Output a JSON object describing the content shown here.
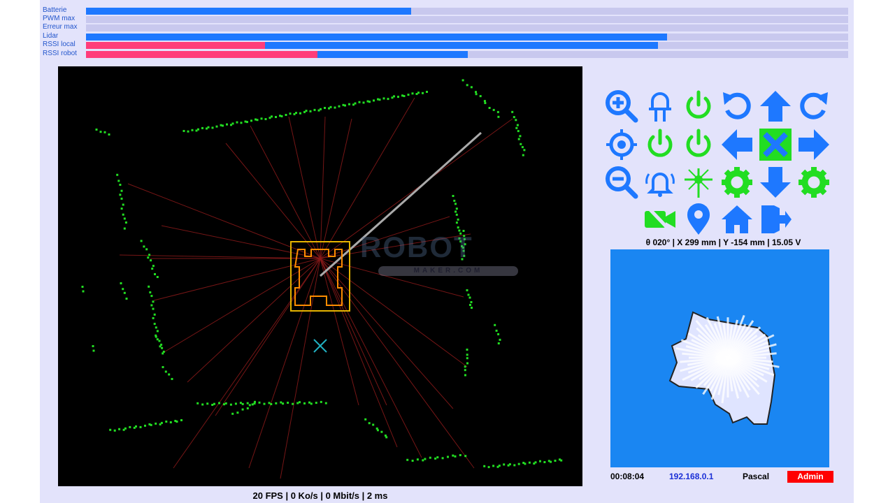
{
  "bars": [
    {
      "label": "Batterie",
      "value": 0.427,
      "secondary": 0
    },
    {
      "label": "PWM max",
      "value": 0,
      "secondary": 0
    },
    {
      "label": "Erreur max",
      "value": 0,
      "secondary": 0
    },
    {
      "label": "Lidar",
      "value": 0.762,
      "secondary": 0
    },
    {
      "label": "RSSI local",
      "value": 0.75,
      "secondary": 0.235
    },
    {
      "label": "RSSI robot",
      "value": 0.501,
      "secondary": 0.304
    }
  ],
  "lidar_view": {
    "status": "20 FPS | 0 Ko/s | 0 Mbit/s | 2 ms",
    "watermark_main": "ROBOT",
    "watermark_sub": "MAKER.COM",
    "colors": {
      "points": "#22dd22",
      "rays": "#8b1a1a",
      "robot": "#ff8c00",
      "frame": "#e6b400",
      "target": "#20b0c0",
      "heading": "#aaaaaa"
    }
  },
  "controls": [
    {
      "name": "zoom-in-icon",
      "color": "#1e78ff"
    },
    {
      "name": "led-icon",
      "color": "#1e78ff"
    },
    {
      "name": "power-1-icon",
      "color": "#22dd22"
    },
    {
      "name": "rotate-left-icon",
      "color": "#1e78ff"
    },
    {
      "name": "arrow-up-icon",
      "color": "#1e78ff"
    },
    {
      "name": "rotate-right-icon",
      "color": "#1e78ff"
    },
    {
      "name": "crosshair-icon",
      "color": "#1e78ff"
    },
    {
      "name": "power-2-icon",
      "color": "#22dd22"
    },
    {
      "name": "power-3-icon",
      "color": "#22dd22"
    },
    {
      "name": "arrow-left-icon",
      "color": "#1e78ff"
    },
    {
      "name": "stop-icon",
      "color": "#22dd22"
    },
    {
      "name": "arrow-right-icon",
      "color": "#1e78ff"
    },
    {
      "name": "zoom-out-icon",
      "color": "#1e78ff"
    },
    {
      "name": "alarm-icon",
      "color": "#1e78ff"
    },
    {
      "name": "laser-icon",
      "color": "#22dd22"
    },
    {
      "name": "gear-1-icon",
      "color": "#22dd22"
    },
    {
      "name": "arrow-down-icon",
      "color": "#1e78ff"
    },
    {
      "name": "gear-2-icon",
      "color": "#22dd22"
    },
    {
      "name": "video-off-icon",
      "color": "#22dd22"
    },
    {
      "name": "map-pin-icon",
      "color": "#1e78ff"
    },
    {
      "name": "home-icon",
      "color": "#1e78ff"
    },
    {
      "name": "logout-icon",
      "color": "#1e78ff"
    }
  ],
  "pose": "θ 020° | X 299 mm | Y -154 mm | 15.05 V",
  "footer": {
    "time": "00:08:04",
    "ip": "192.168.0.1",
    "user": "Pascal",
    "role": "Admin"
  },
  "colors": {
    "accent": "#1e78ff",
    "green": "#22dd22",
    "pink": "#ff3d7a",
    "red": "#ff0000",
    "background": "#e3e3fb"
  }
}
